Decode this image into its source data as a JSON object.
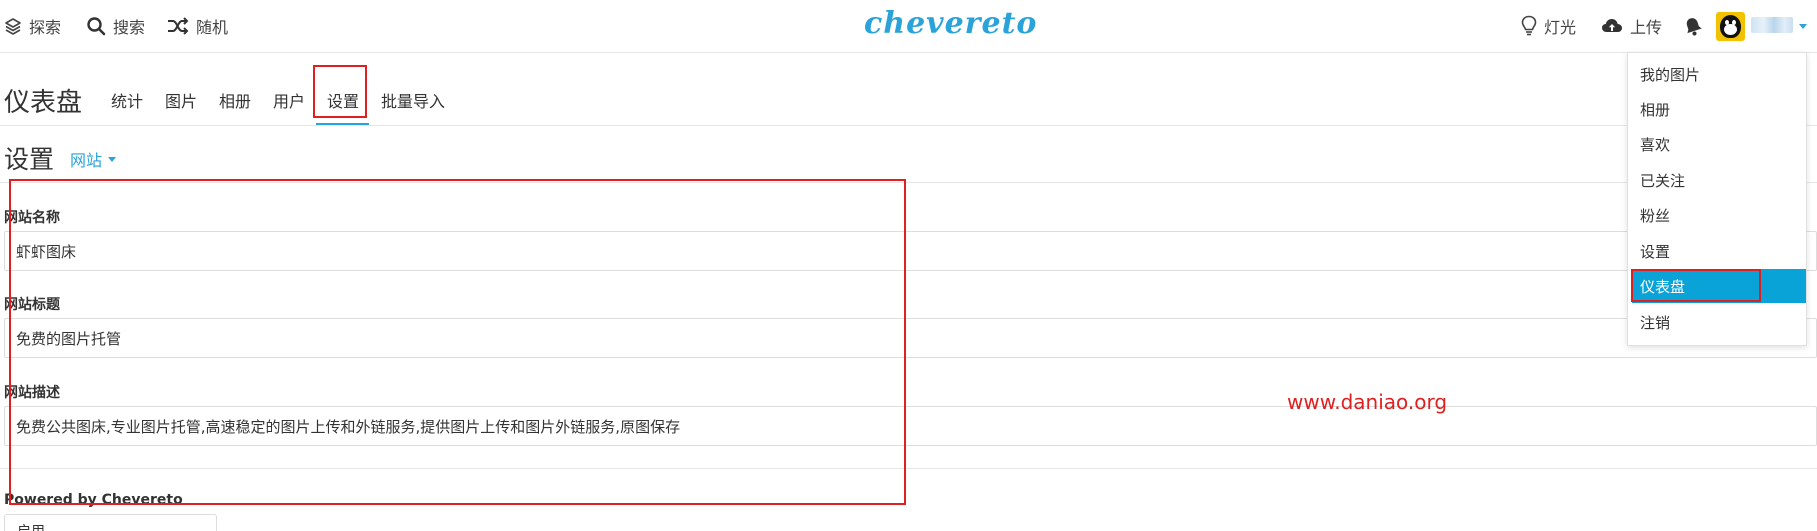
{
  "topbar": {
    "explore_label": "探索",
    "search_label": "搜索",
    "random_label": "随机",
    "logo_text": "chevereto",
    "light_label": "灯光",
    "upload_label": "上传"
  },
  "dashboard": {
    "title": "仪表盘",
    "tabs": [
      {
        "label": "统计"
      },
      {
        "label": "图片"
      },
      {
        "label": "相册"
      },
      {
        "label": "用户"
      },
      {
        "label": "设置"
      },
      {
        "label": "批量导入"
      }
    ],
    "active_tab": "设置"
  },
  "settings": {
    "title": "设置",
    "section_label": "网站"
  },
  "form": {
    "site_name": {
      "label": "网站名称",
      "value": "虾虾图床"
    },
    "site_title": {
      "label": "网站标题",
      "value": "免费的图片托管"
    },
    "site_description": {
      "label": "网站描述",
      "value": "免费公共图床,专业图片托管,高速稳定的图片上传和外链服务,提供图片上传和图片外链服务,原图保存"
    },
    "powered_by": {
      "label": "Powered by Chevereto",
      "value": "启用"
    }
  },
  "user_menu": {
    "items": [
      {
        "label": "我的图片"
      },
      {
        "label": "相册"
      },
      {
        "label": "喜欢"
      },
      {
        "label": "已关注"
      },
      {
        "label": "粉丝"
      },
      {
        "label": "设置"
      },
      {
        "label": "仪表盘"
      },
      {
        "label": "注销"
      }
    ],
    "active_item": "仪表盘"
  },
  "watermark": "www.daniao.org",
  "colors": {
    "accent": "#2aa3d8",
    "menu_active": "#0aa3d8",
    "annotation": "#e02020"
  },
  "icons": [
    "layers-icon",
    "search-icon",
    "shuffle-icon",
    "lightbulb-icon",
    "cloud-upload-icon",
    "bell-icon"
  ]
}
